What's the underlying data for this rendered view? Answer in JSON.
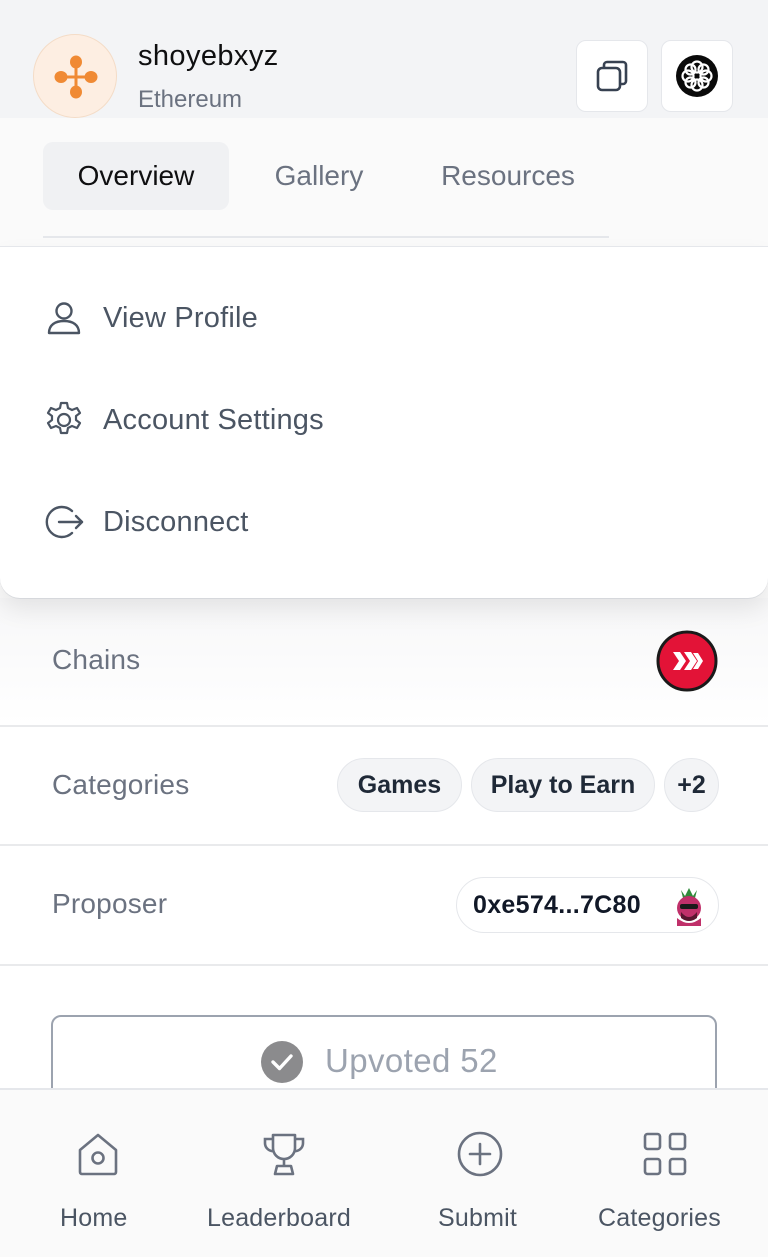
{
  "header": {
    "username": "shoyebxyz",
    "network": "Ethereum",
    "avatar_icon": "orange-dots-logo-icon",
    "copy_icon": "copy-icon",
    "brand_icon": "flower-logo-icon"
  },
  "tabs": [
    {
      "label": "Overview",
      "active": true
    },
    {
      "label": "Gallery",
      "active": false
    },
    {
      "label": "Resources",
      "active": false
    }
  ],
  "menu": {
    "items": [
      {
        "label": "View Profile",
        "icon": "user-icon"
      },
      {
        "label": "Account Settings",
        "icon": "gear-icon"
      },
      {
        "label": "Disconnect",
        "icon": "logout-icon"
      }
    ]
  },
  "details": {
    "chains_label": "Chains",
    "chain_icon": "hive-logo-icon",
    "categories_label": "Categories",
    "categories": [
      "Games",
      "Play to Earn"
    ],
    "categories_more": "+2",
    "proposer_label": "Proposer",
    "proposer_address": "0xe574...7C80"
  },
  "upvote": {
    "label": "Upvoted 52",
    "icon": "check-circle-icon"
  },
  "bottom_nav": [
    {
      "label": "Home",
      "icon": "home-icon"
    },
    {
      "label": "Leaderboard",
      "icon": "trophy-icon"
    },
    {
      "label": "Submit",
      "icon": "plus-circle-icon"
    },
    {
      "label": "Categories",
      "icon": "grid-icon"
    }
  ],
  "colors": {
    "accent_orange": "#f08a34",
    "hive_red": "#e31337",
    "text_muted": "#6b7280"
  }
}
